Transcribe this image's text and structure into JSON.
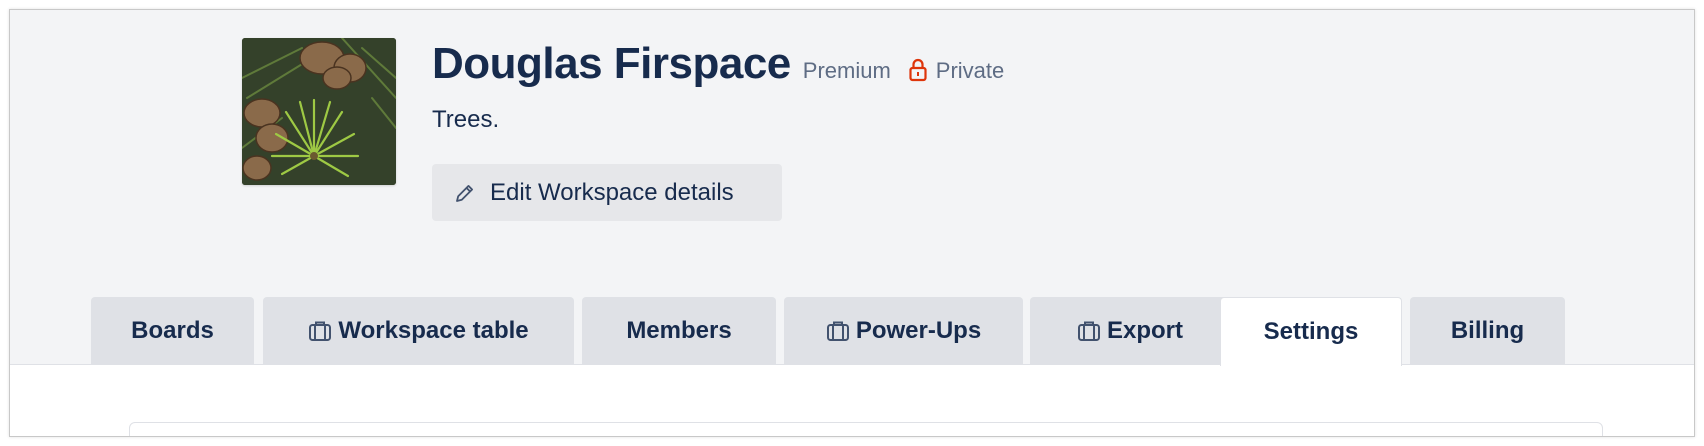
{
  "workspace": {
    "name": "Douglas Firspace",
    "plan": "Premium",
    "privacy": "Private",
    "description": "Trees.",
    "edit_label": "Edit Workspace details"
  },
  "tabs": [
    {
      "label": "Boards",
      "icon": null,
      "active": false
    },
    {
      "label": "Workspace table",
      "icon": "briefcase-icon",
      "active": false
    },
    {
      "label": "Members",
      "icon": null,
      "active": false
    },
    {
      "label": "Power-Ups",
      "icon": "briefcase-icon",
      "active": false
    },
    {
      "label": "Export",
      "icon": "briefcase-icon",
      "active": false
    },
    {
      "label": "Settings",
      "icon": null,
      "active": true
    },
    {
      "label": "Billing",
      "icon": null,
      "active": false
    }
  ],
  "colors": {
    "text_primary": "#172b4d",
    "text_secondary": "#5e6c84",
    "lock_red": "#de350b",
    "header_bg": "#f3f4f6",
    "tab_bg": "#dfe1e6",
    "button_bg": "#e6e7ea"
  }
}
